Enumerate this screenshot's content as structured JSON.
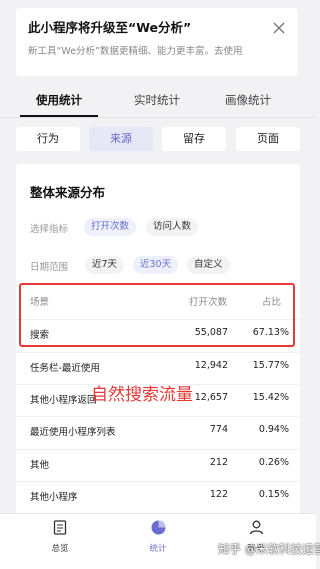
{
  "banner": {
    "title": "此小程序将升级至“We分析”",
    "desc": "新工具“We分析”数据更精细、能力更丰富。去使用",
    "close_icon": "close-icon"
  },
  "tabs": [
    "使用统计",
    "实时统计",
    "画像统计"
  ],
  "segments": [
    "行为",
    "来源",
    "留存",
    "页面"
  ],
  "card": {
    "title": "整体来源分布",
    "metric_label": "选择指标",
    "metric_chips": [
      "打开次数",
      "访问人数"
    ],
    "date_label": "日期范围",
    "date_chips": [
      "近7天",
      "近30天",
      "自定义"
    ]
  },
  "table": {
    "headers": [
      "场景",
      "打开次数",
      "占比"
    ],
    "rows": [
      [
        "搜索",
        "55,087",
        "67.13%"
      ],
      [
        "任务栏-最近使用",
        "12,942",
        "15.77%"
      ],
      [
        "其他小程序返回",
        "12,657",
        "15.42%"
      ],
      [
        "最近使用小程序列表",
        "774",
        "0.94%"
      ],
      [
        "其他",
        "212",
        "0.26%"
      ],
      [
        "其他小程序",
        "122",
        "0.15%"
      ]
    ]
  },
  "annotation": "自然搜索流量",
  "bottom_nav": [
    "总览",
    "统计",
    "账号"
  ],
  "watermark": "知乎 @米软科技运营",
  "colors": {
    "accent": "#6a6dd0",
    "highlight": "#e53935"
  }
}
